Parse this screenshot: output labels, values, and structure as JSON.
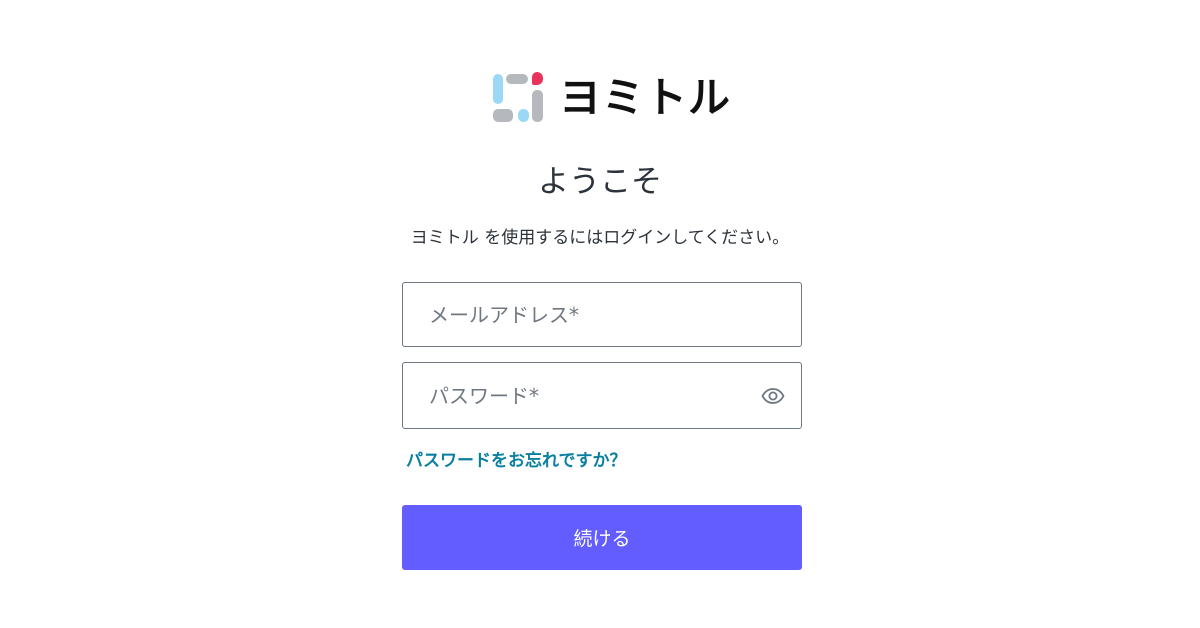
{
  "logo": {
    "mark_icon": "yomitoru-logo-mark-icon",
    "wordmark": "ヨミトル",
    "colors": {
      "blue": "#9ad8f5",
      "gray": "#b5b8bc",
      "red": "#e8345a"
    }
  },
  "heading": {
    "title": "ようこそ",
    "subtitle": "ヨミトル を使用するにはログインしてください。"
  },
  "form": {
    "email_placeholder": "メールアドレス*",
    "email_value": "",
    "password_placeholder": "パスワード*",
    "password_value": "",
    "show_password_icon": "eye-icon",
    "forgot_password": "パスワードをお忘れですか？",
    "continue_label": "続ける"
  },
  "colors": {
    "accent": "#635dff",
    "link": "#0a7fa1",
    "text": "#2d333a",
    "border": "#6f7780"
  }
}
